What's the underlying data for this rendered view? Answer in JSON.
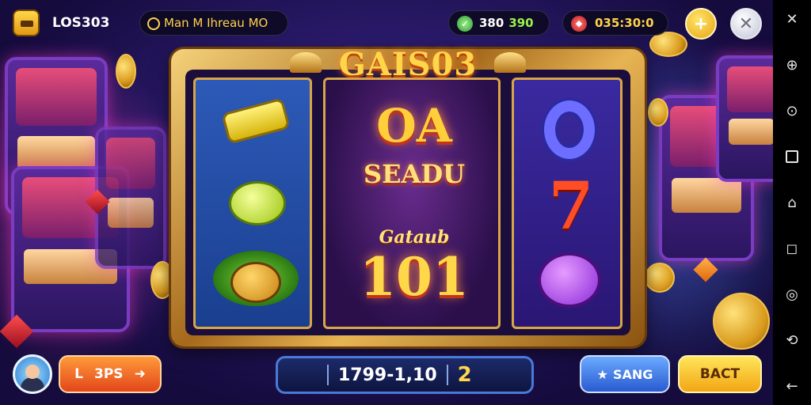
{
  "header": {
    "brand": "LOS303",
    "user_label": "Man M Ihreau MO",
    "balance_main": "380",
    "balance_bonus": "390",
    "gems": "035:30:0",
    "add_symbol": "+",
    "close_symbol": "✕"
  },
  "machine": {
    "title": "GAIS03",
    "center_line1": "OA",
    "center_line2": "SEADU",
    "center_line3": "Gataub",
    "center_line4": "101",
    "right_seven": "7"
  },
  "footer": {
    "left_button_letter": "L",
    "left_button_label": "3PS",
    "left_button_arrow": "➜",
    "counter_value": "1799-1,10",
    "counter_multiplier": "2",
    "blue_button_label": "SANG",
    "yellow_button_label": "BACT"
  },
  "nav_rail": [
    "✕",
    "⊕",
    "⊙",
    "□",
    "⌂",
    "◻",
    "◎",
    "⟲",
    "←"
  ],
  "colors": {
    "gold": "#ffd54a",
    "orange_button": "#ff9a3a",
    "blue_button": "#2a5ad0",
    "yellow_button": "#ffe55a"
  }
}
